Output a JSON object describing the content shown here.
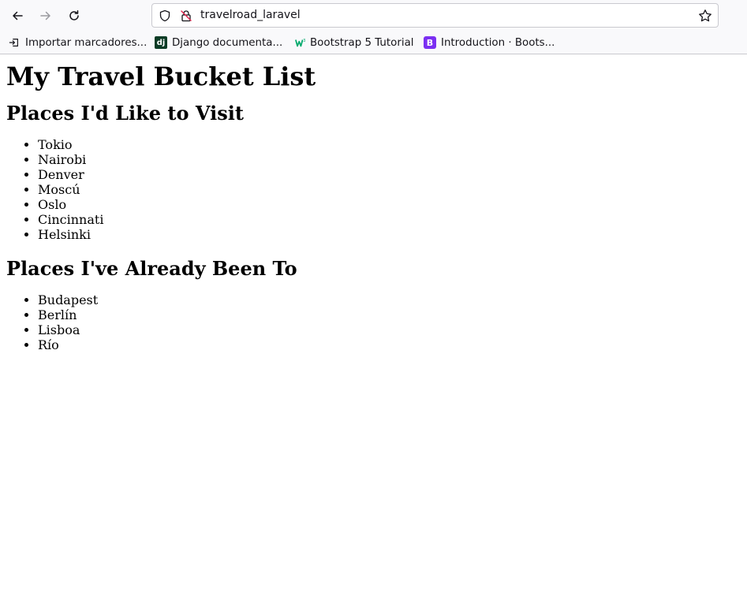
{
  "browser": {
    "url": "travelroad_laravel",
    "bookmarks": [
      {
        "label": "Importar marcadores...",
        "icon": "import-icon"
      },
      {
        "label": "Django documenta...",
        "icon": "django-icon"
      },
      {
        "label": "Bootstrap 5 Tutorial",
        "icon": "w3schools-icon"
      },
      {
        "label": "Introduction · Boots...",
        "icon": "bootstrap-icon"
      }
    ]
  },
  "page": {
    "title": "My Travel Bucket List",
    "wish_section": {
      "heading": "Places I'd Like to Visit",
      "places": [
        "Tokio",
        "Nairobi",
        "Denver",
        "Moscú",
        "Oslo",
        "Cincinnati",
        "Helsinki"
      ]
    },
    "visited_section": {
      "heading": "Places I've Already Been To",
      "places": [
        "Budapest",
        "Berlín",
        "Lisboa",
        "Río"
      ]
    }
  }
}
